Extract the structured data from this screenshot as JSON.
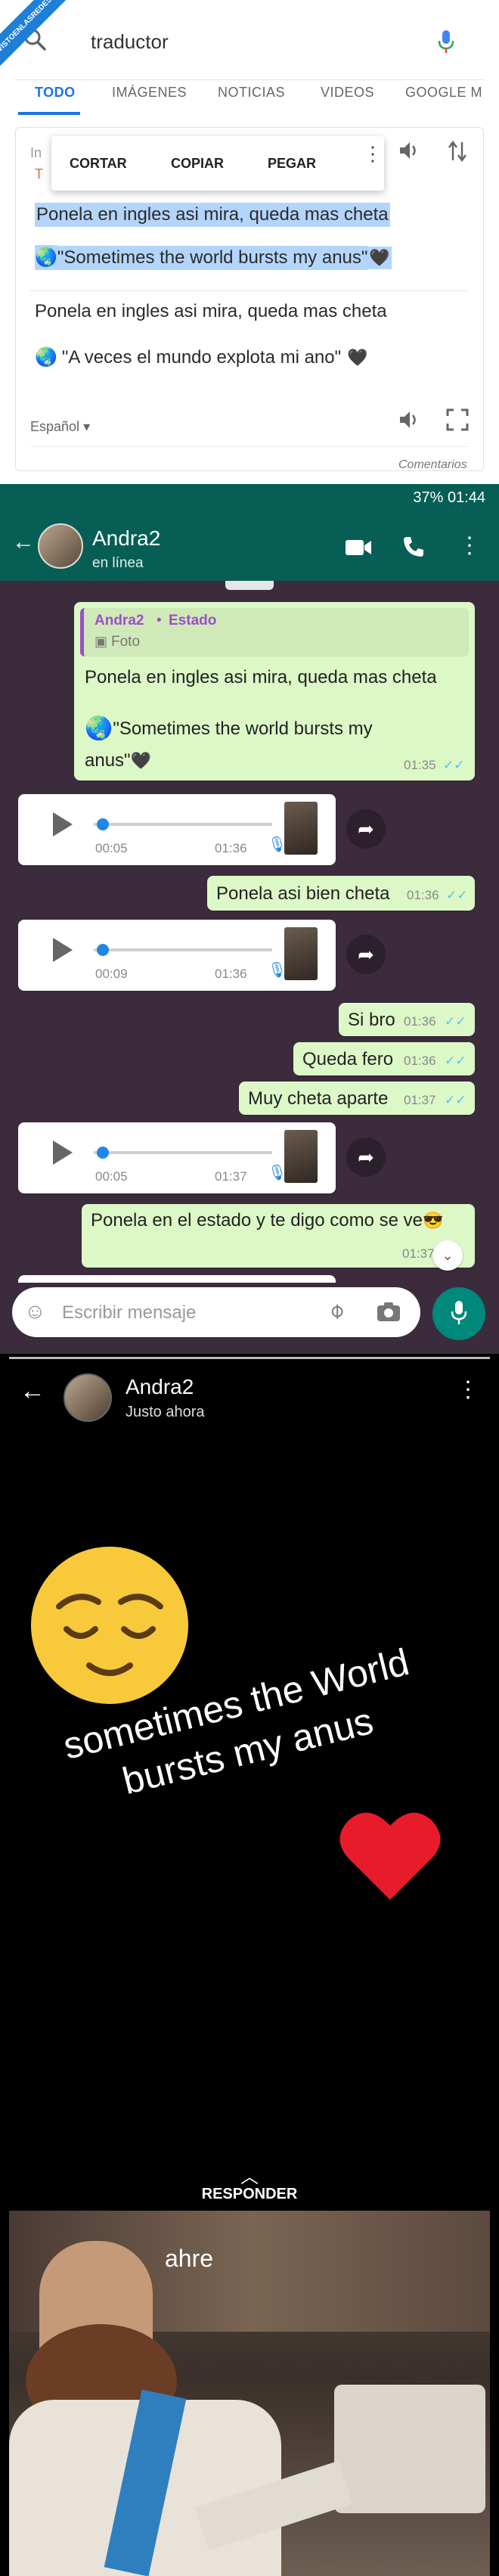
{
  "watermark": "VISTOENLASREDES",
  "translate": {
    "query": "traductor",
    "tabs": [
      "TODO",
      "IMÁGENES",
      "NOTICIAS",
      "VIDEOS",
      "GOOGLE M"
    ],
    "context_menu": [
      "CORTAR",
      "COPIAR",
      "PEGAR"
    ],
    "source_peek": [
      "In",
      "T"
    ],
    "selected_source": "Ponela en ingles asi mira, queda mas cheta",
    "selected_translation": "\"Sometimes the world bursts my anus\"",
    "source_text": "Ponela en ingles asi mira, queda mas cheta",
    "translation_text": "\"A veces el mundo explota mi ano\"",
    "language": "Español",
    "footer": "Comentarios"
  },
  "chat": {
    "status_bar": "37% 01:44",
    "contact_name": "Andra2",
    "contact_status": "en línea",
    "quote": {
      "author": "Andra2",
      "type": "Estado",
      "media": "Foto",
      "line1": "Ponela en ingles asi mira, queda mas cheta",
      "line2": "\"Sometimes the world bursts my",
      "line3": "anus\"",
      "time": "01:35"
    },
    "voice_notes": [
      {
        "duration": "00:05",
        "time": "01:36"
      },
      {
        "duration": "00:09",
        "time": "01:36"
      },
      {
        "duration": "00:05",
        "time": "01:37"
      }
    ],
    "messages": [
      {
        "text": "Ponela asi bien cheta",
        "time": "01:36"
      },
      {
        "text": "Si bro",
        "time": "01:36"
      },
      {
        "text": "Queda fero",
        "time": "01:36"
      },
      {
        "text": "Muy cheta aparte",
        "time": "01:37"
      },
      {
        "text": "Ponela en el estado y te digo como se ve",
        "time": "01:37"
      }
    ],
    "input_placeholder": "Escribir mensaje"
  },
  "story": {
    "name": "Andra2",
    "time": "Justo ahora",
    "text_line1": "sometimes the World",
    "text_line2": "bursts my  anus",
    "reply_label": "RESPONDER",
    "caption": "ahre"
  },
  "colors": {
    "google_blue": "#1a73e8",
    "whatsapp_green": "#075e54",
    "bubble_out": "#dcf8c6",
    "chat_bg": "#3b2b3d"
  }
}
